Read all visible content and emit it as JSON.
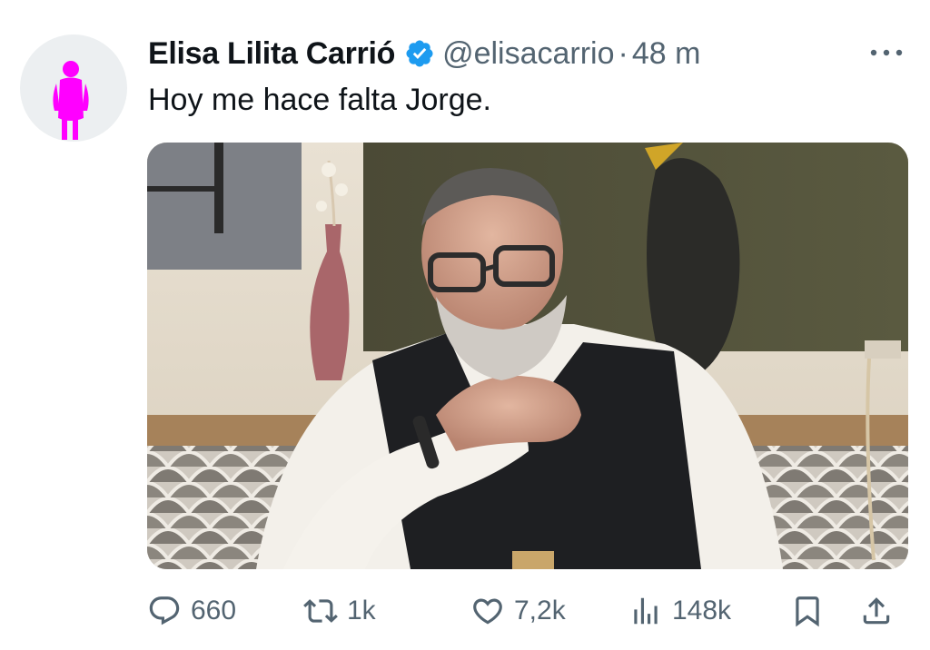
{
  "author": {
    "display_name": "Elisa Lilita Carrió",
    "handle": "@elisacarrio",
    "separator": "·",
    "time": "48 m",
    "verified": true,
    "avatar_icon": "pink-silhouette-icon",
    "avatar_color": "#ff00ff"
  },
  "tweet": {
    "text": "Hoy me hace falta Jorge."
  },
  "media": {
    "type": "photo"
  },
  "actions": {
    "replies": "660",
    "retweets": "1k",
    "likes": "7,2k",
    "views": "148k",
    "icons": [
      "reply-icon",
      "retweet-icon",
      "like-icon",
      "views-icon",
      "bookmark-icon",
      "share-icon"
    ]
  },
  "colors": {
    "verified_blue": "#1d9bf0",
    "secondary_text": "#536471",
    "primary_text": "#0f1419"
  }
}
